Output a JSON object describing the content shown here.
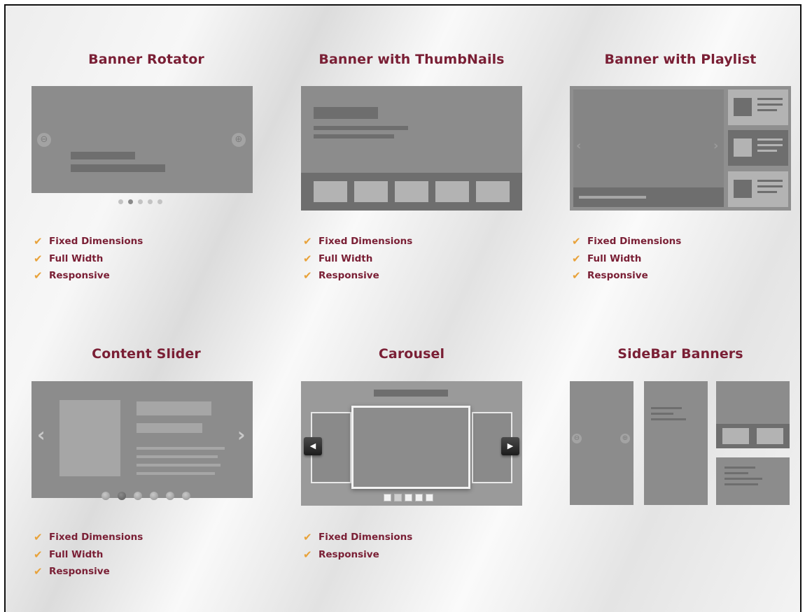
{
  "cards": [
    {
      "title": "Banner Rotator",
      "features": [
        "Fixed Dimensions",
        "Full Width",
        "Responsive"
      ]
    },
    {
      "title": "Banner with ThumbNails",
      "features": [
        "Fixed Dimensions",
        "Full Width",
        "Responsive"
      ]
    },
    {
      "title": "Banner with Playlist",
      "features": [
        "Fixed Dimensions",
        "Full Width",
        "Responsive"
      ]
    },
    {
      "title": "Content Slider",
      "features": [
        "Fixed Dimensions",
        "Full Width",
        "Responsive"
      ]
    },
    {
      "title": "Carousel",
      "features": [
        "Fixed Dimensions",
        "Responsive"
      ]
    },
    {
      "title": "SideBar Banners",
      "features": []
    }
  ],
  "icons": {
    "check": "check-icon",
    "prev": "arrow-left-icon",
    "next": "arrow-right-icon"
  },
  "glyphs": {
    "check": "✔",
    "circle_prev": "⊖",
    "circle_next": "⊕",
    "chev_left": "‹",
    "chev_right": "›",
    "carousel_prev": "◀",
    "carousel_next": "▶",
    "sidebar_prev": "⊖",
    "sidebar_next": "⊕"
  },
  "rotator": {
    "dots": 5,
    "active_dot": 1
  },
  "slider": {
    "dots": 6,
    "active_dot": 1
  },
  "carousel": {
    "dots": 5,
    "active_dot": 1
  },
  "colors": {
    "title": "#7a1f35",
    "check": "#e8a23a",
    "mockup": "#8c8c8c",
    "mockup_dark": "#6e6e6e",
    "mockup_light": "#a6a6a6"
  }
}
